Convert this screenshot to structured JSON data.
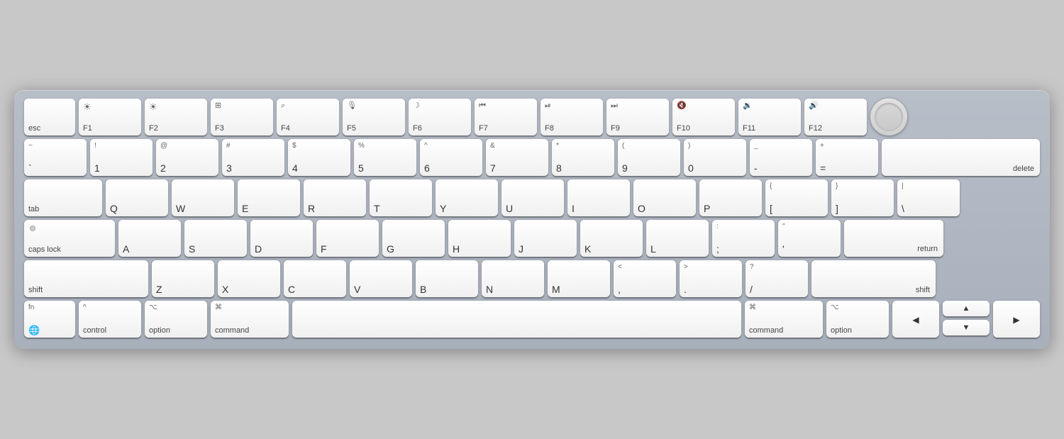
{
  "keyboard": {
    "rows": {
      "row0": {
        "keys": [
          {
            "id": "esc",
            "label": "esc",
            "type": "esc"
          },
          {
            "id": "f1",
            "top": "☀",
            "bottom": "F1",
            "type": "f"
          },
          {
            "id": "f2",
            "top": "☀",
            "bottom": "F2",
            "type": "f"
          },
          {
            "id": "f3",
            "top": "⊞",
            "bottom": "F3",
            "type": "f"
          },
          {
            "id": "f4",
            "top": "🔍",
            "bottom": "F4",
            "type": "f"
          },
          {
            "id": "f5",
            "top": "🎙",
            "bottom": "F5",
            "type": "f"
          },
          {
            "id": "f6",
            "top": "☽",
            "bottom": "F6",
            "type": "f"
          },
          {
            "id": "f7",
            "top": "⏮",
            "bottom": "F7",
            "type": "f"
          },
          {
            "id": "f8",
            "top": "⏯",
            "bottom": "F8",
            "type": "f"
          },
          {
            "id": "f9",
            "top": "⏭",
            "bottom": "F9",
            "type": "f"
          },
          {
            "id": "f10",
            "top": "🔇",
            "bottom": "F10",
            "type": "f"
          },
          {
            "id": "f11",
            "top": "🔉",
            "bottom": "F11",
            "type": "f"
          },
          {
            "id": "f12",
            "top": "🔊",
            "bottom": "F12",
            "type": "f"
          },
          {
            "id": "touchid",
            "type": "touchid"
          }
        ]
      },
      "row1": {
        "keys": [
          {
            "id": "tilde",
            "top": "~",
            "bottom": "`",
            "type": "standard"
          },
          {
            "id": "1",
            "top": "!",
            "bottom": "1",
            "type": "standard"
          },
          {
            "id": "2",
            "top": "@",
            "bottom": "2",
            "type": "standard"
          },
          {
            "id": "3",
            "top": "#",
            "bottom": "3",
            "type": "standard"
          },
          {
            "id": "4",
            "top": "$",
            "bottom": "4",
            "type": "standard"
          },
          {
            "id": "5",
            "top": "%",
            "bottom": "5",
            "type": "standard"
          },
          {
            "id": "6",
            "top": "^",
            "bottom": "6",
            "type": "standard"
          },
          {
            "id": "7",
            "top": "&",
            "bottom": "7",
            "type": "standard"
          },
          {
            "id": "8",
            "top": "*",
            "bottom": "8",
            "type": "standard"
          },
          {
            "id": "9",
            "top": "(",
            "bottom": "9",
            "type": "standard"
          },
          {
            "id": "0",
            "top": ")",
            "bottom": "0",
            "type": "standard"
          },
          {
            "id": "minus",
            "top": "_",
            "bottom": "-",
            "type": "standard"
          },
          {
            "id": "equals",
            "top": "+",
            "bottom": "=",
            "type": "standard"
          },
          {
            "id": "delete",
            "label": "delete",
            "type": "delete"
          }
        ]
      },
      "row2": {
        "keys": [
          {
            "id": "tab",
            "label": "tab",
            "type": "tab"
          },
          {
            "id": "q",
            "main": "Q",
            "type": "standard"
          },
          {
            "id": "w",
            "main": "W",
            "type": "standard"
          },
          {
            "id": "e",
            "main": "E",
            "type": "standard"
          },
          {
            "id": "r",
            "main": "R",
            "type": "standard"
          },
          {
            "id": "t",
            "main": "T",
            "type": "standard"
          },
          {
            "id": "y",
            "main": "Y",
            "type": "standard"
          },
          {
            "id": "u",
            "main": "U",
            "type": "standard"
          },
          {
            "id": "i",
            "main": "I",
            "type": "standard"
          },
          {
            "id": "o",
            "main": "O",
            "type": "standard"
          },
          {
            "id": "p",
            "main": "P",
            "type": "standard"
          },
          {
            "id": "lbracket",
            "top": "{",
            "bottom": "[",
            "type": "standard"
          },
          {
            "id": "rbracket",
            "top": "}",
            "bottom": "]",
            "type": "standard"
          },
          {
            "id": "backslash",
            "top": "|",
            "bottom": "\\",
            "type": "backslash"
          }
        ]
      },
      "row3": {
        "keys": [
          {
            "id": "capslock",
            "label": "caps lock",
            "type": "caps"
          },
          {
            "id": "a",
            "main": "A",
            "type": "standard"
          },
          {
            "id": "s",
            "main": "S",
            "type": "standard"
          },
          {
            "id": "d",
            "main": "D",
            "type": "standard"
          },
          {
            "id": "f",
            "main": "F",
            "type": "standard"
          },
          {
            "id": "g",
            "main": "G",
            "type": "standard"
          },
          {
            "id": "h",
            "main": "H",
            "type": "standard"
          },
          {
            "id": "j",
            "main": "J",
            "type": "standard"
          },
          {
            "id": "k",
            "main": "K",
            "type": "standard"
          },
          {
            "id": "l",
            "main": "L",
            "type": "standard"
          },
          {
            "id": "semicolon",
            "top": ":",
            "bottom": ";",
            "type": "standard"
          },
          {
            "id": "quote",
            "top": "\"",
            "bottom": "'",
            "type": "standard"
          },
          {
            "id": "return",
            "label": "return",
            "type": "return"
          }
        ]
      },
      "row4": {
        "keys": [
          {
            "id": "shift-l",
            "label": "shift",
            "type": "shift-l"
          },
          {
            "id": "z",
            "main": "Z",
            "type": "standard"
          },
          {
            "id": "x",
            "main": "X",
            "type": "standard"
          },
          {
            "id": "c",
            "main": "C",
            "type": "standard"
          },
          {
            "id": "v",
            "main": "V",
            "type": "standard"
          },
          {
            "id": "b",
            "main": "B",
            "type": "standard"
          },
          {
            "id": "n",
            "main": "N",
            "type": "standard"
          },
          {
            "id": "m",
            "main": "M",
            "type": "standard"
          },
          {
            "id": "comma",
            "top": "<",
            "bottom": ",",
            "type": "standard"
          },
          {
            "id": "period",
            "top": ">",
            "bottom": ".",
            "type": "standard"
          },
          {
            "id": "slash",
            "top": "?",
            "bottom": "/",
            "type": "standard"
          },
          {
            "id": "shift-r",
            "label": "shift",
            "type": "shift-r"
          }
        ]
      },
      "row5": {
        "keys": [
          {
            "id": "fn",
            "top": "fn",
            "bottom": "🌐",
            "type": "fn"
          },
          {
            "id": "control",
            "top": "^",
            "bottom": "control",
            "type": "control"
          },
          {
            "id": "option-l",
            "top": "⌥",
            "bottom": "option",
            "type": "option"
          },
          {
            "id": "command-l",
            "top": "⌘",
            "bottom": "command",
            "type": "command"
          },
          {
            "id": "space",
            "type": "space"
          },
          {
            "id": "command-r",
            "top": "⌘",
            "bottom": "command",
            "type": "command"
          },
          {
            "id": "option-r",
            "top": "⌥",
            "bottom": "option",
            "type": "option"
          },
          {
            "id": "arrow-left",
            "main": "◀",
            "type": "arrow"
          },
          {
            "id": "arrow-up",
            "main": "▲",
            "type": "arrow-up"
          },
          {
            "id": "arrow-down",
            "main": "▼",
            "type": "arrow-down"
          },
          {
            "id": "arrow-right",
            "main": "▶",
            "type": "arrow"
          }
        ]
      }
    }
  }
}
